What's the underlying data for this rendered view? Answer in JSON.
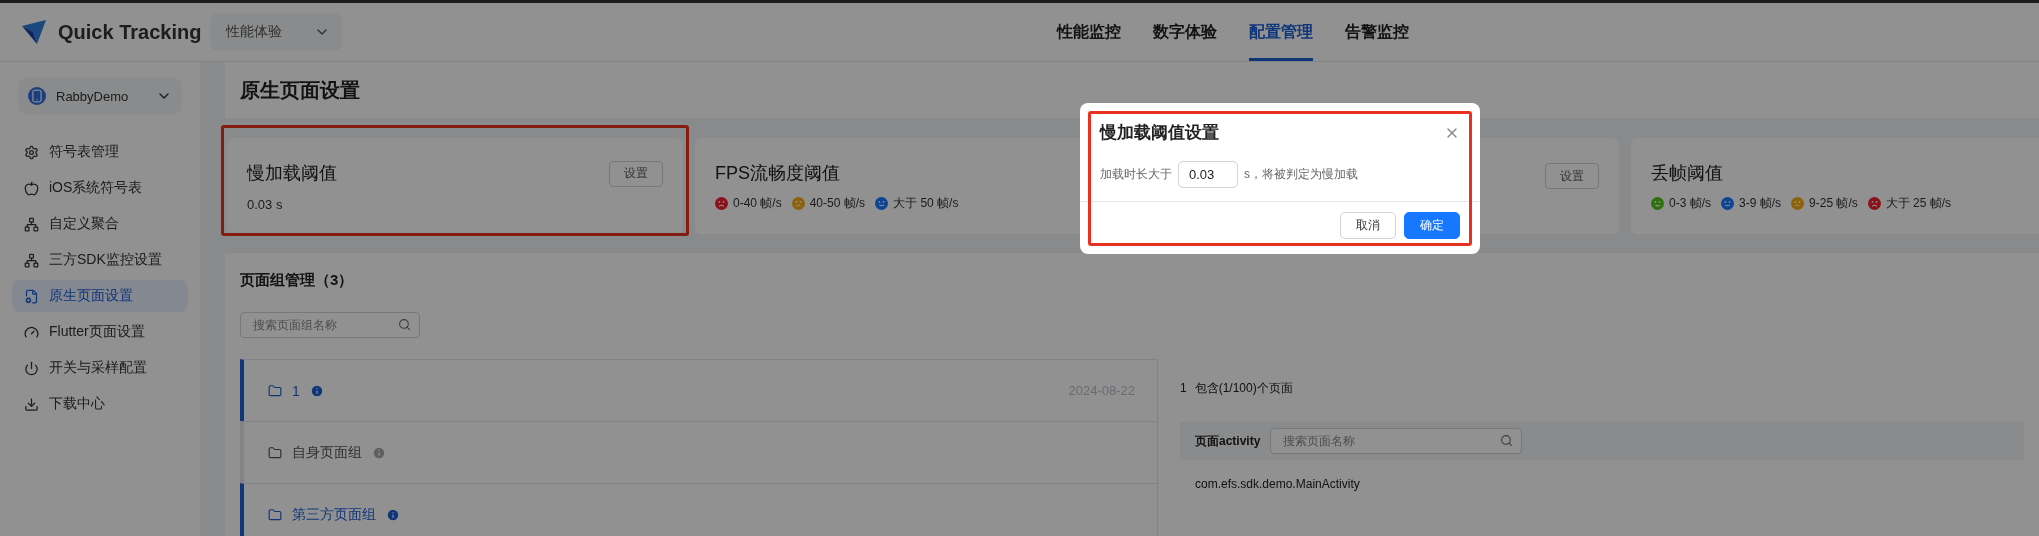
{
  "header": {
    "logo_text": "Quick Tracking",
    "product_select": "性能体验",
    "nav": [
      {
        "label": "性能监控",
        "selected": false
      },
      {
        "label": "数字体验",
        "selected": false
      },
      {
        "label": "配置管理",
        "selected": true
      },
      {
        "label": "告警监控",
        "selected": false
      }
    ]
  },
  "sidebar": {
    "app_select": "RabbyDemo",
    "items": [
      {
        "label": "符号表管理",
        "selected": false
      },
      {
        "label": "iOS系统符号表",
        "selected": false
      },
      {
        "label": "自定义聚合",
        "selected": false
      },
      {
        "label": "三方SDK监控设置",
        "selected": false
      },
      {
        "label": "原生页面设置",
        "selected": true
      },
      {
        "label": "Flutter页面设置",
        "selected": false
      },
      {
        "label": "开关与采样配置",
        "selected": false
      },
      {
        "label": "下载中心",
        "selected": false
      }
    ]
  },
  "page_title": "原生页面设置",
  "threshold_cards": [
    {
      "kind": "value",
      "title": "慢加载阈值",
      "value": "0.03 s",
      "button": "设置",
      "highlighted": true
    },
    {
      "kind": "legend",
      "title": "FPS流畅度阈值",
      "legend": [
        {
          "kind": "sad",
          "color": "#8b131a",
          "text": "0-40 帧/s"
        },
        {
          "kind": "neutral",
          "color": "#8e620b",
          "text": "40-50 帧/s"
        },
        {
          "kind": "smile",
          "color": "#0d4491",
          "text": "大于 50 帧/s"
        }
      ]
    },
    {
      "kind": "covered",
      "button": "设置"
    },
    {
      "kind": "legend",
      "title": "丢帧阈值",
      "legend": [
        {
          "kind": "laugh",
          "color": "#2f6f0f",
          "text": "0-3 帧/s"
        },
        {
          "kind": "smile",
          "color": "#0d4491",
          "text": "3-9 帧/s"
        },
        {
          "kind": "neutral",
          "color": "#8e620b",
          "text": "9-25 帧/s"
        },
        {
          "kind": "sad",
          "color": "#8b131a",
          "text": "大于 25 帧/s"
        }
      ]
    }
  ],
  "page_groups": {
    "title": "页面组管理（3）",
    "search_placeholder": "搜索页面组名称",
    "groups": [
      {
        "name": "1",
        "selected": true,
        "date": "2024-08-22"
      },
      {
        "name": "自身页面组",
        "selected": false
      },
      {
        "name": "第三方页面组",
        "selected": true
      }
    ],
    "detail": {
      "index": "1",
      "summary": "包含(1/100)个页面",
      "column_label": "页面activity",
      "search_placeholder": "搜索页面名称",
      "pages": [
        "com.efs.sdk.demo.MainActivity"
      ]
    }
  },
  "modal": {
    "title": "慢加载阈值设置",
    "label": "加载时长大于",
    "value": "0.03",
    "suffix": "s，将被判定为慢加载",
    "highlighted": true,
    "buttons": [
      {
        "label": "取消",
        "kind": "default"
      },
      {
        "label": "确定",
        "kind": "primary"
      }
    ]
  }
}
